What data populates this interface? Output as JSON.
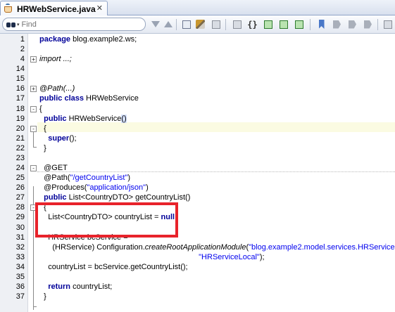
{
  "tab": {
    "title": "HRWebService.java",
    "close": "✕",
    "icon": "java-file-icon"
  },
  "toolbar": {
    "find_placeholder": "Find",
    "buttons": [
      "find-previous-icon",
      "find-next-icon",
      "toggle-highlight-icon",
      "clear-highlight-icon",
      "remove-highlight-icon",
      "quick-outline-icon",
      "reformat-icon",
      "toggle-comment-icon",
      "uncomment-icon",
      "indent-icon",
      "toggle-bookmark-icon",
      "next-bookmark-icon",
      "previous-bookmark-icon",
      "go-to-bookmark-icon",
      "bookmark-icon",
      "more-icon"
    ]
  },
  "editor": {
    "lines": [
      {
        "n": "1",
        "parts": [
          {
            "t": "package",
            "c": "kw"
          },
          {
            "t": " blog.example2.ws;"
          }
        ]
      },
      {
        "n": "2",
        "parts": []
      },
      {
        "n": "4",
        "fold": "+",
        "parts": [
          {
            "t": "import ...;",
            "c": "it"
          }
        ]
      },
      {
        "n": "14",
        "parts": []
      },
      {
        "n": "15",
        "parts": []
      },
      {
        "n": "16",
        "fold": "+",
        "parts": [
          {
            "t": "@Path(...)",
            "c": "it"
          }
        ]
      },
      {
        "n": "17",
        "parts": [
          {
            "t": "public",
            "c": "kw"
          },
          {
            "t": " "
          },
          {
            "t": "class",
            "c": "kw"
          },
          {
            "t": " HRWebService"
          }
        ]
      },
      {
        "n": "18",
        "fold": "-",
        "parts": [
          {
            "t": "{"
          }
        ]
      },
      {
        "n": "19",
        "hl": true,
        "parts": [
          {
            "t": "  "
          },
          {
            "t": "public",
            "c": "kw"
          },
          {
            "t": " HRWebService"
          },
          {
            "t": "()",
            "c": "br"
          }
        ]
      },
      {
        "n": "20",
        "fold": "-",
        "parts": [
          {
            "t": "  {"
          }
        ]
      },
      {
        "n": "21",
        "parts": [
          {
            "t": "    "
          },
          {
            "t": "super",
            "c": "kw"
          },
          {
            "t": "();"
          }
        ]
      },
      {
        "n": "22",
        "parts": [
          {
            "t": "  }"
          }
        ]
      },
      {
        "n": "23",
        "parts": []
      },
      {
        "n": "24",
        "fold": "-",
        "parts": [
          {
            "t": "  @GET"
          }
        ]
      },
      {
        "n": "25",
        "parts": [
          {
            "t": "  @Path("
          },
          {
            "t": "\"/getCountryList\"",
            "c": "str"
          },
          {
            "t": ")"
          }
        ]
      },
      {
        "n": "26",
        "parts": [
          {
            "t": "  @Produces("
          },
          {
            "t": "\"application/json\"",
            "c": "str"
          },
          {
            "t": ")"
          }
        ]
      },
      {
        "n": "27",
        "parts": [
          {
            "t": "  "
          },
          {
            "t": "public",
            "c": "kw"
          },
          {
            "t": " List<CountryDTO> getCountryList()"
          }
        ]
      },
      {
        "n": "28",
        "fold": "-",
        "parts": [
          {
            "t": "  {"
          }
        ]
      },
      {
        "n": "29",
        "parts": [
          {
            "t": "    List<CountryDTO> countryList = "
          },
          {
            "t": "null",
            "c": "kw"
          },
          {
            "t": ";"
          }
        ]
      },
      {
        "n": "30",
        "parts": []
      },
      {
        "n": "31",
        "parts": [
          {
            "t": "    HRService bcService ="
          }
        ]
      },
      {
        "n": "32",
        "parts": [
          {
            "t": "      (HRService) Configuration."
          },
          {
            "t": "createRootApplicationModule",
            "c": "mth"
          },
          {
            "t": "("
          },
          {
            "t": "\"blog.example2.model.services.HRService\"",
            "c": "str"
          },
          {
            "t": ","
          }
        ]
      },
      {
        "n": "33",
        "parts": [
          {
            "t": "                                                                          "
          },
          {
            "t": "\"HRServiceLocal\"",
            "c": "str"
          },
          {
            "t": ");"
          }
        ]
      },
      {
        "n": "34",
        "parts": [
          {
            "t": "    countryList = bcService.getCountryList();"
          }
        ]
      },
      {
        "n": "35",
        "parts": []
      },
      {
        "n": "36",
        "parts": [
          {
            "t": "    "
          },
          {
            "t": "return",
            "c": "kw"
          },
          {
            "t": " countryList;"
          }
        ]
      },
      {
        "n": "37",
        "parts": [
          {
            "t": "  }"
          }
        ]
      }
    ]
  },
  "colors": {
    "highlight_box": "#e8232b",
    "keyword": "#000099",
    "string": "#0000ee",
    "current_line": "#fbfbe2"
  }
}
